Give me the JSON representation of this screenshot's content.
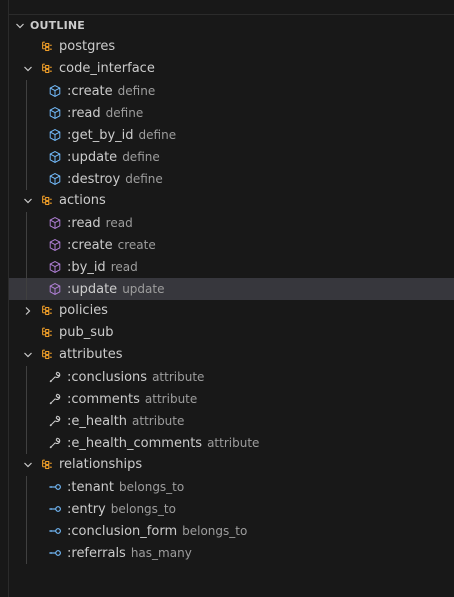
{
  "header": {
    "title": "OUTLINE"
  },
  "colors": {
    "module_icon": "#ee9d28",
    "method_icon": "#75beff",
    "event_icon": "#b180d7",
    "property_icon": "#cccccc",
    "field_icon": "#75beff",
    "selected_row": "#37373d"
  },
  "items": [
    {
      "label": "postgres",
      "detail": "",
      "icon": "module-icon",
      "expandable": false
    },
    {
      "label": "code_interface",
      "detail": "",
      "icon": "module-icon",
      "expandable": true,
      "expanded": true,
      "children": [
        {
          "label": ":create",
          "detail": "define",
          "icon": "method-icon"
        },
        {
          "label": ":read",
          "detail": "define",
          "icon": "method-icon"
        },
        {
          "label": ":get_by_id",
          "detail": "define",
          "icon": "method-icon"
        },
        {
          "label": ":update",
          "detail": "define",
          "icon": "method-icon"
        },
        {
          "label": ":destroy",
          "detail": "define",
          "icon": "method-icon"
        }
      ]
    },
    {
      "label": "actions",
      "detail": "",
      "icon": "module-icon",
      "expandable": true,
      "expanded": true,
      "children": [
        {
          "label": ":read",
          "detail": "read",
          "icon": "event-icon"
        },
        {
          "label": ":create",
          "detail": "create",
          "icon": "event-icon"
        },
        {
          "label": ":by_id",
          "detail": "read",
          "icon": "event-icon"
        },
        {
          "label": ":update",
          "detail": "update",
          "icon": "event-icon",
          "selected": true
        }
      ]
    },
    {
      "label": "policies",
      "detail": "",
      "icon": "module-icon",
      "expandable": true,
      "expanded": false
    },
    {
      "label": "pub_sub",
      "detail": "",
      "icon": "module-icon",
      "expandable": false
    },
    {
      "label": "attributes",
      "detail": "",
      "icon": "module-icon",
      "expandable": true,
      "expanded": true,
      "children": [
        {
          "label": ":conclusions",
          "detail": "attribute",
          "icon": "wrench-icon"
        },
        {
          "label": ":comments",
          "detail": "attribute",
          "icon": "wrench-icon"
        },
        {
          "label": ":e_health",
          "detail": "attribute",
          "icon": "wrench-icon"
        },
        {
          "label": ":e_health_comments",
          "detail": "attribute",
          "icon": "wrench-icon"
        }
      ]
    },
    {
      "label": "relationships",
      "detail": "",
      "icon": "module-icon",
      "expandable": true,
      "expanded": true,
      "children": [
        {
          "label": ":tenant",
          "detail": "belongs_to",
          "icon": "field-icon"
        },
        {
          "label": ":entry",
          "detail": "belongs_to",
          "icon": "field-icon"
        },
        {
          "label": ":conclusion_form",
          "detail": "belongs_to",
          "icon": "field-icon"
        },
        {
          "label": ":referrals",
          "detail": "has_many",
          "icon": "field-icon"
        }
      ]
    }
  ]
}
